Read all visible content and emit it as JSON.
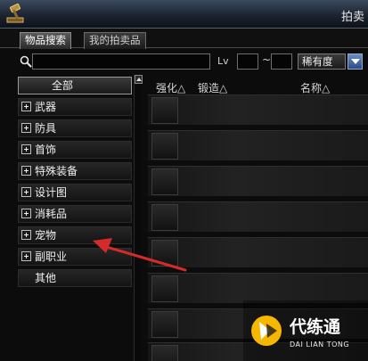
{
  "window": {
    "title": "拍卖"
  },
  "tabs": [
    {
      "label": "物品搜索",
      "active": true
    },
    {
      "label": "我的拍卖品",
      "active": false
    }
  ],
  "search": {
    "value": "",
    "placeholder": "",
    "lv_label": "Lv",
    "lv_min": "",
    "lv_max": "",
    "range_sep": "~",
    "rarity_selected": "稀有度"
  },
  "categories": [
    {
      "label": "全部",
      "expandable": false,
      "selected": true
    },
    {
      "label": "武器",
      "expandable": true
    },
    {
      "label": "防具",
      "expandable": true
    },
    {
      "label": "首饰",
      "expandable": true
    },
    {
      "label": "特殊装备",
      "expandable": true
    },
    {
      "label": "设计图",
      "expandable": true
    },
    {
      "label": "消耗品",
      "expandable": true
    },
    {
      "label": "宠物",
      "expandable": true
    },
    {
      "label": "副职业",
      "expandable": true
    },
    {
      "label": "其他",
      "expandable": false
    }
  ],
  "columns": [
    "强化△",
    "锻造△",
    "名称△"
  ],
  "result_rows": 8,
  "colors": {
    "arrow": "#d42a2a",
    "accent_yellow": "#f6b700"
  },
  "watermark": {
    "brand": "代练通",
    "sub": "DAI LIAN TONG"
  }
}
